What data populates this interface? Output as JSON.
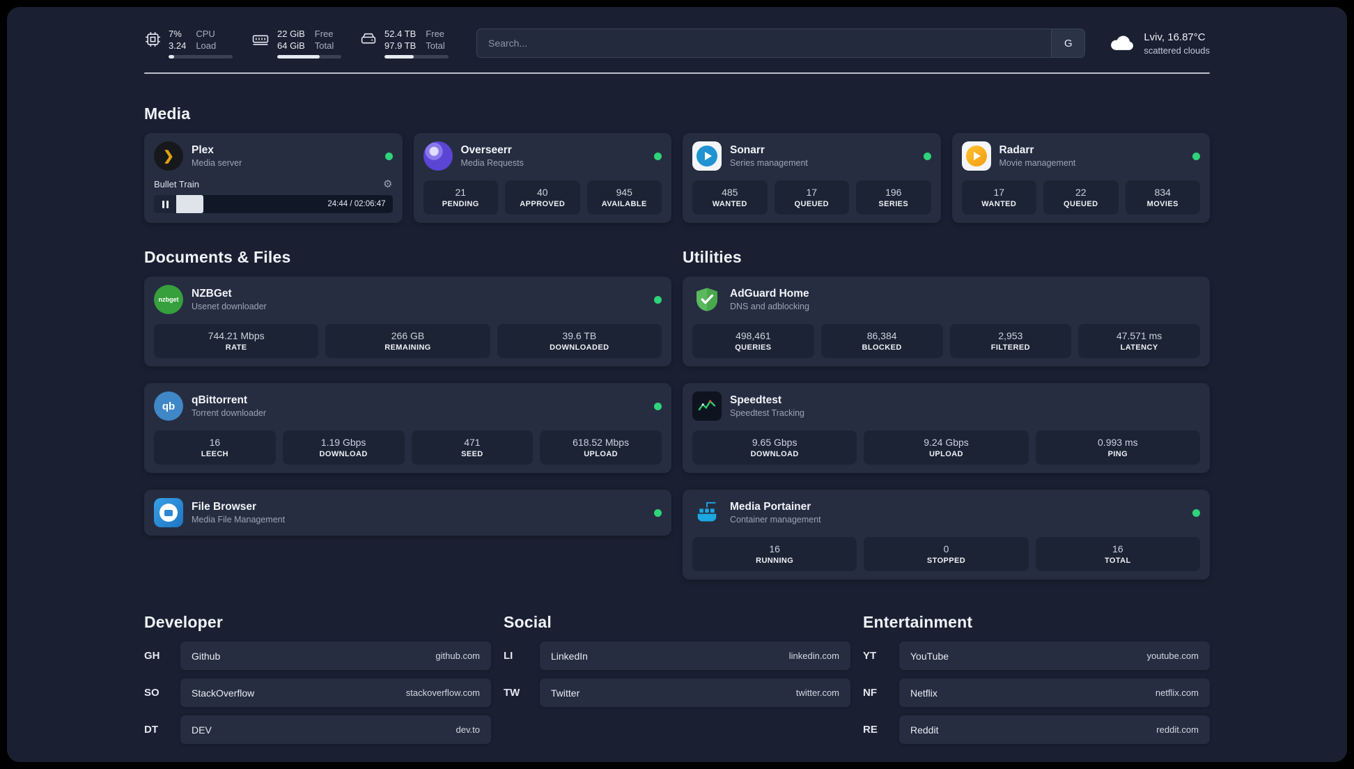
{
  "topbar": {
    "cpu": {
      "value_top": "7%",
      "value_bottom": "3.24",
      "label_top": "CPU",
      "label_bottom": "Load",
      "fill": "9%"
    },
    "ram": {
      "value_top": "22 GiB",
      "value_bottom": "64 GiB",
      "label_top": "Free",
      "label_bottom": "Total",
      "fill": "66%"
    },
    "disk": {
      "value_top": "52.4 TB",
      "value_bottom": "97.9 TB",
      "label_top": "Free",
      "label_bottom": "Total",
      "fill": "46%"
    },
    "search": {
      "placeholder": "Search...",
      "engine_label": "G"
    },
    "weather": {
      "location": "Lviv, 16.87°C",
      "condition": "scattered clouds"
    }
  },
  "sections": {
    "media": {
      "title": "Media",
      "services": [
        {
          "name": "Plex",
          "desc": "Media server",
          "online": true,
          "player": {
            "track": "Bullet Train",
            "time": "24:44 / 02:06:47",
            "progress": "19%"
          }
        },
        {
          "name": "Overseerr",
          "desc": "Media Requests",
          "online": true,
          "stats": [
            {
              "value": "21",
              "label": "PENDING"
            },
            {
              "value": "40",
              "label": "APPROVED"
            },
            {
              "value": "945",
              "label": "AVAILABLE"
            }
          ]
        },
        {
          "name": "Sonarr",
          "desc": "Series management",
          "online": true,
          "stats": [
            {
              "value": "485",
              "label": "WANTED"
            },
            {
              "value": "17",
              "label": "QUEUED"
            },
            {
              "value": "196",
              "label": "SERIES"
            }
          ]
        },
        {
          "name": "Radarr",
          "desc": "Movie management",
          "online": true,
          "stats": [
            {
              "value": "17",
              "label": "WANTED"
            },
            {
              "value": "22",
              "label": "QUEUED"
            },
            {
              "value": "834",
              "label": "MOVIES"
            }
          ]
        }
      ]
    },
    "documents": {
      "title": "Documents & Files",
      "services": [
        {
          "name": "NZBGet",
          "desc": "Usenet downloader",
          "online": true,
          "icon_text": "nzbget",
          "stats": [
            {
              "value": "744.21 Mbps",
              "label": "RATE"
            },
            {
              "value": "266 GB",
              "label": "REMAINING"
            },
            {
              "value": "39.6 TB",
              "label": "DOWNLOADED"
            }
          ]
        },
        {
          "name": "qBittorrent",
          "desc": "Torrent downloader",
          "online": true,
          "icon_text": "qb",
          "stats": [
            {
              "value": "16",
              "label": "LEECH"
            },
            {
              "value": "1.19 Gbps",
              "label": "DOWNLOAD"
            },
            {
              "value": "471",
              "label": "SEED"
            },
            {
              "value": "618.52 Mbps",
              "label": "UPLOAD"
            }
          ]
        },
        {
          "name": "File Browser",
          "desc": "Media File Management",
          "online": true
        }
      ]
    },
    "utilities": {
      "title": "Utilities",
      "services": [
        {
          "name": "AdGuard Home",
          "desc": "DNS and adblocking",
          "stats": [
            {
              "value": "498,461",
              "label": "QUERIES"
            },
            {
              "value": "86,384",
              "label": "BLOCKED"
            },
            {
              "value": "2,953",
              "label": "FILTERED"
            },
            {
              "value": "47.571 ms",
              "label": "LATENCY"
            }
          ]
        },
        {
          "name": "Speedtest",
          "desc": "Speedtest Tracking",
          "stats": [
            {
              "value": "9.65 Gbps",
              "label": "DOWNLOAD"
            },
            {
              "value": "9.24 Gbps",
              "label": "UPLOAD"
            },
            {
              "value": "0.993 ms",
              "label": "PING"
            }
          ]
        },
        {
          "name": "Media Portainer",
          "desc": "Container management",
          "online": true,
          "stats": [
            {
              "value": "16",
              "label": "RUNNING"
            },
            {
              "value": "0",
              "label": "STOPPED"
            },
            {
              "value": "16",
              "label": "TOTAL"
            }
          ]
        }
      ]
    }
  },
  "bookmarks": [
    {
      "title": "Developer",
      "links": [
        {
          "abbr": "GH",
          "name": "Github",
          "url": "github.com"
        },
        {
          "abbr": "SO",
          "name": "StackOverflow",
          "url": "stackoverflow.com"
        },
        {
          "abbr": "DT",
          "name": "DEV",
          "url": "dev.to"
        }
      ]
    },
    {
      "title": "Social",
      "links": [
        {
          "abbr": "LI",
          "name": "LinkedIn",
          "url": "linkedin.com"
        },
        {
          "abbr": "TW",
          "name": "Twitter",
          "url": "twitter.com"
        }
      ]
    },
    {
      "title": "Entertainment",
      "links": [
        {
          "abbr": "YT",
          "name": "YouTube",
          "url": "youtube.com"
        },
        {
          "abbr": "NF",
          "name": "Netflix",
          "url": "netflix.com"
        },
        {
          "abbr": "RE",
          "name": "Reddit",
          "url": "reddit.com"
        }
      ]
    }
  ],
  "colors": {
    "status_online": "#2fd379",
    "plex_accent": "#e5a00d",
    "background": "#1a2032",
    "card": "#262d41"
  }
}
